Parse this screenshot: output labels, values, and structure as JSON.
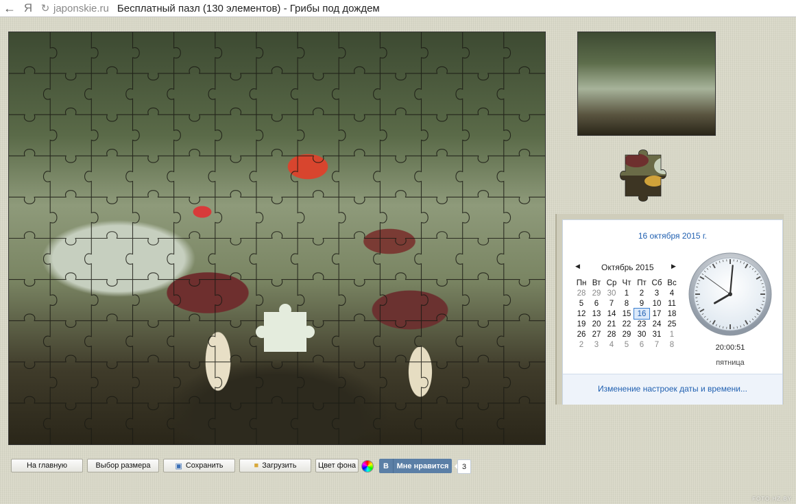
{
  "browser": {
    "back_icon": "back-arrow-icon",
    "yandex_label": "Я",
    "reload_icon": "reload-icon",
    "domain": "japonskie.ru",
    "title": "Бесплатный пазл (130 элементов) - Грибы под дождем"
  },
  "calendar": {
    "date_link": "16 октября 2015 г.",
    "month_label": "Октябрь 2015",
    "weekdays": [
      "Пн",
      "Вт",
      "Ср",
      "Чт",
      "Пт",
      "Сб",
      "Вс"
    ],
    "weeks": [
      [
        "28",
        "29",
        "30",
        "1",
        "2",
        "3",
        "4"
      ],
      [
        "5",
        "6",
        "7",
        "8",
        "9",
        "10",
        "11"
      ],
      [
        "12",
        "13",
        "14",
        "15",
        "16",
        "17",
        "18"
      ],
      [
        "19",
        "20",
        "21",
        "22",
        "23",
        "24",
        "25"
      ],
      [
        "26",
        "27",
        "28",
        "29",
        "30",
        "31",
        "1"
      ],
      [
        "2",
        "3",
        "4",
        "5",
        "6",
        "7",
        "8"
      ]
    ],
    "today": "16",
    "time": "20:00:51",
    "weekday": "пятница",
    "clock": {
      "hours": 20,
      "minutes": 0,
      "seconds": 51
    },
    "settings_link": "Изменение настроек даты и времени..."
  },
  "toolbar": {
    "home_label": "На главную",
    "size_label": "Выбор размера",
    "save_label": "Сохранить",
    "load_label": "Загрузить",
    "bgcolor_label": "Цвет фона",
    "vk_logo": "В",
    "vk_like_label": "Мне нравится",
    "vk_count": "3"
  },
  "watermark": "FOTO.HZ.BY",
  "colors": {
    "link_blue": "#1f5fb0",
    "vk_blue": "#5b7fa6",
    "page_bg": "#d9d8c8",
    "hole_fill": "#e4ecdd"
  }
}
